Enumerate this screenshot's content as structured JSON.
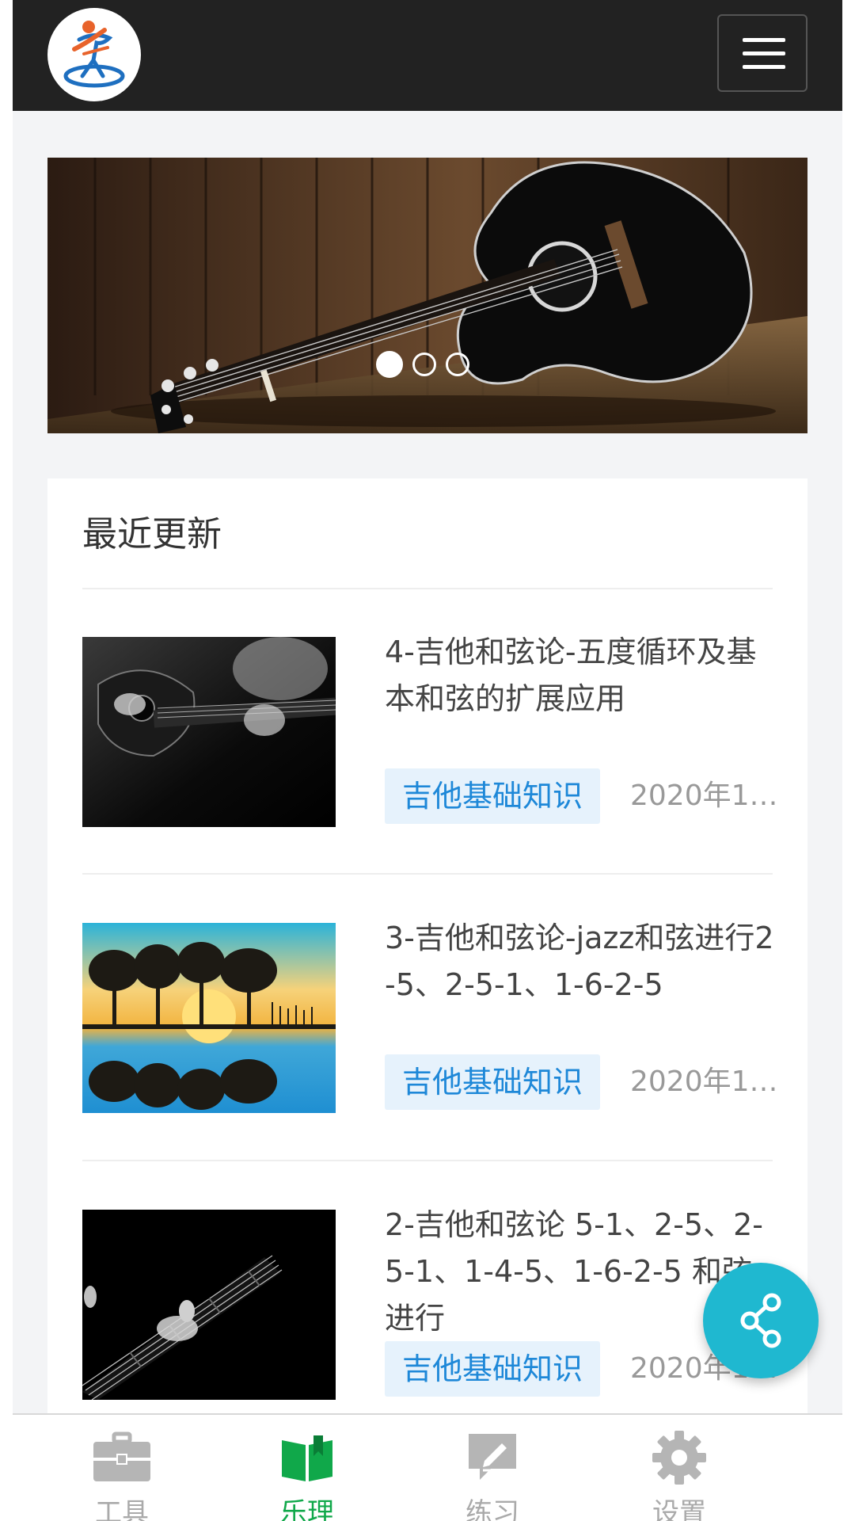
{
  "header": {
    "logo_alt": "logo",
    "menu_icon": "hamburger-menu-icon"
  },
  "banner": {
    "slides_total": 3,
    "active_slide": 1
  },
  "section": {
    "title": "最近更新"
  },
  "articles": [
    {
      "title": "4-吉他和弦论-五度循环及基本和弦的扩展应用",
      "tag": "吉他基础知识",
      "date": "2020年10..."
    },
    {
      "title": "3-吉他和弦论-jazz和弦进行2-5、2-5-1、1-6-2-5",
      "tag": "吉他基础知识",
      "date": "2020年10..."
    },
    {
      "title": "2-吉他和弦论 5-1、2-5、2-5-1、1-4-5、1-6-2-5 和弦进行",
      "tag": "吉他基础知识",
      "date": "2020年10..."
    }
  ],
  "fab": {
    "icon": "share-icon"
  },
  "tabs": [
    {
      "label": "工具",
      "icon": "toolbox-icon",
      "active": false
    },
    {
      "label": "乐理",
      "icon": "book-icon",
      "active": true
    },
    {
      "label": "练习",
      "icon": "practice-edit-icon",
      "active": false
    },
    {
      "label": "设置",
      "icon": "gear-icon",
      "active": false
    }
  ],
  "colors": {
    "header_bg": "#222222",
    "accent_blue": "#1e88d8",
    "tag_bg": "#e6f2fc",
    "active_tab": "#10a84a",
    "fab": "#1fb8d0"
  }
}
